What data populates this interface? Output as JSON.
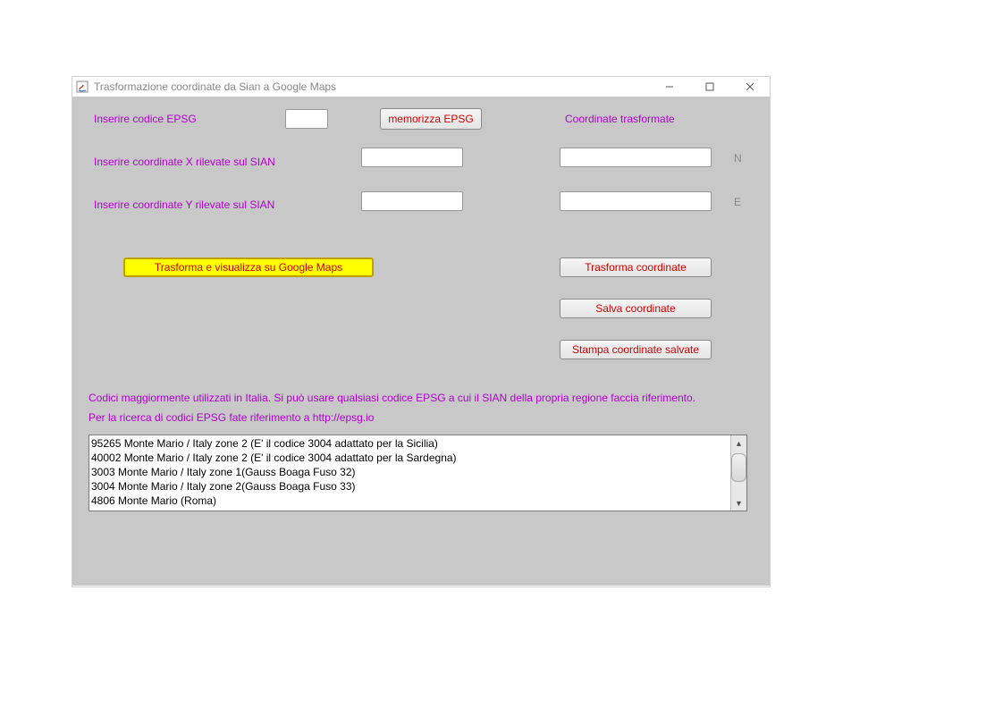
{
  "window": {
    "title": "Trasformazione coordinate da Sian a Google Maps"
  },
  "labels": {
    "epsg": "Inserire codice EPSG",
    "coord_x": "Inserire coordinate X rilevate sul SIAN",
    "coord_y": "Inserire coordinate Y rilevate sul SIAN",
    "coord_transformed": "Coordinate trasformate",
    "n_suffix": "N",
    "e_suffix": "E",
    "info1": "Codici maggiormente utilizzati in Italia. Si può usare qualsiasi codice EPSG a cui il SIAN della propria regione faccia riferimento.",
    "info2": "Per la ricerca di codici EPSG fate riferimento a  http://epsg.io"
  },
  "buttons": {
    "memorize": "memorizza EPSG",
    "transform_view": "Trasforma e visualizza su Google Maps",
    "transform": "Trasforma coordinate",
    "save": "Salva coordinate",
    "print": "Stampa coordinate salvate"
  },
  "inputs": {
    "epsg": "",
    "x": "",
    "y": "",
    "out_n": "",
    "out_e": ""
  },
  "list": {
    "items": [
      "95265 Monte Mario / Italy zone 2 (E' il codice 3004 adattato per la Sicilia)",
      "40002 Monte Mario / Italy zone 2 (E' il codice 3004 adattato per la Sardegna)",
      "3003 Monte Mario / Italy zone 1(Gauss Boaga Fuso 32)",
      "3004 Monte Mario / Italy zone 2(Gauss Boaga Fuso 33)",
      "4806 Monte Mario (Roma)"
    ]
  }
}
